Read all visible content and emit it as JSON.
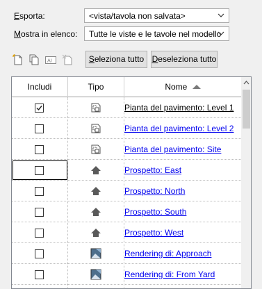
{
  "export": {
    "label": "Esporta:",
    "value": "<vista/tavola non salvata>"
  },
  "list_filter": {
    "label": "Mostra in elenco:",
    "value": "Tutte le viste e le tavole nel modello"
  },
  "buttons": {
    "select_all": "Seleziona tutto",
    "deselect_all": "Deseleziona tutto"
  },
  "table": {
    "columns": [
      "Includi",
      "Tipo",
      "Nome"
    ],
    "sort": "ascending",
    "rows": [
      {
        "checked": true,
        "type_icon": "sheet-icon",
        "name": "Pianta del pavimento: Level 1"
      },
      {
        "checked": false,
        "type_icon": "sheet-icon",
        "name": "Pianta del pavimento: Level 2"
      },
      {
        "checked": false,
        "type_icon": "sheet-icon",
        "name": "Pianta del pavimento: Site"
      },
      {
        "checked": false,
        "type_icon": "elevation-icon",
        "name": "Prospetto: East"
      },
      {
        "checked": false,
        "type_icon": "elevation-icon",
        "name": "Prospetto: North"
      },
      {
        "checked": false,
        "type_icon": "elevation-icon",
        "name": "Prospetto: South"
      },
      {
        "checked": false,
        "type_icon": "elevation-icon",
        "name": "Prospetto: West"
      },
      {
        "checked": false,
        "type_icon": "rendering-icon",
        "name": "Rendering di: Approach"
      },
      {
        "checked": false,
        "type_icon": "rendering-icon",
        "name": "Rendering di: From Yard"
      }
    ]
  },
  "colors": {
    "link": "#0000ee",
    "header_border": "#9b9b9b",
    "window_bg": "#f0f0f0"
  }
}
